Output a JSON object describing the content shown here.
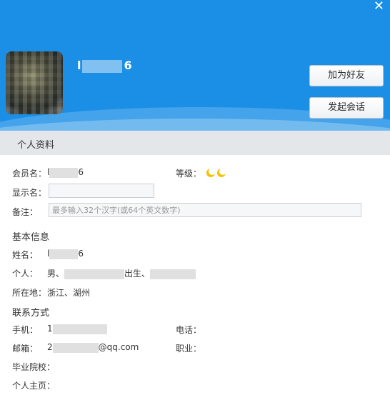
{
  "window": {
    "close_icon": "close-icon"
  },
  "profile": {
    "username_prefix": "l",
    "username_suffix": "6",
    "add_friend_label": "加为好友",
    "start_chat_label": "发起会话"
  },
  "section": {
    "title": "个人资料"
  },
  "fields": {
    "member_label": "会员名：",
    "member_prefix": "l",
    "member_suffix": "6",
    "level_label": "等级：",
    "display_label": "显示名：",
    "note_label": "备注：",
    "note_placeholder": "最多输入32个汉字(或64个英文数字)"
  },
  "basic": {
    "heading": "基本信息",
    "name_label": "姓名：",
    "name_prefix": "l",
    "name_suffix": "6",
    "personal_label": "个人：",
    "gender": "男、",
    "birth_text": "出生、",
    "location_label": "所在地：",
    "location_value": "浙江、湖州"
  },
  "contact": {
    "heading": "联系方式",
    "phone_label": "手机：",
    "phone_prefix": "1",
    "tel_label": "电话：",
    "email_label": "邮箱：",
    "email_prefix": "2",
    "email_suffix": "@qq.com",
    "job_label": "职业：",
    "school_label": "毕业院校：",
    "homepage_label": "个人主页："
  }
}
